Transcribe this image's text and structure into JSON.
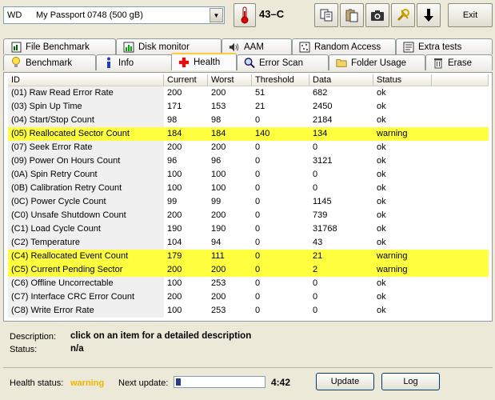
{
  "toolbar": {
    "drive_brand": "WD",
    "drive_model": "My Passport 0748 (500 gB)",
    "temperature": "43–C",
    "exit_label": "Exit"
  },
  "tabs_row1": [
    {
      "label": "File Benchmark",
      "icon": "file-benchmark-icon"
    },
    {
      "label": "Disk monitor",
      "icon": "disk-monitor-icon"
    },
    {
      "label": "AAM",
      "icon": "speaker-icon"
    },
    {
      "label": "Random Access",
      "icon": "random-access-icon"
    },
    {
      "label": "Extra tests",
      "icon": "extra-tests-icon"
    }
  ],
  "tabs_row2": [
    {
      "label": "Benchmark",
      "icon": "benchmark-icon"
    },
    {
      "label": "Info",
      "icon": "info-icon"
    },
    {
      "label": "Health",
      "icon": "health-icon",
      "active": true
    },
    {
      "label": "Error Scan",
      "icon": "error-scan-icon"
    },
    {
      "label": "Folder Usage",
      "icon": "folder-icon"
    },
    {
      "label": "Erase",
      "icon": "erase-icon"
    }
  ],
  "table": {
    "headers": [
      "ID",
      "Current",
      "Worst",
      "Threshold",
      "Data",
      "Status"
    ],
    "rows": [
      [
        "(01) Raw Read Error Rate",
        "200",
        "200",
        "51",
        "682",
        "ok"
      ],
      [
        "(03) Spin Up Time",
        "171",
        "153",
        "21",
        "2450",
        "ok"
      ],
      [
        "(04) Start/Stop Count",
        "98",
        "98",
        "0",
        "2184",
        "ok"
      ],
      [
        "(05) Reallocated Sector Count",
        "184",
        "184",
        "140",
        "134",
        "warning"
      ],
      [
        "(07) Seek Error Rate",
        "200",
        "200",
        "0",
        "0",
        "ok"
      ],
      [
        "(09) Power On Hours Count",
        "96",
        "96",
        "0",
        "3121",
        "ok"
      ],
      [
        "(0A) Spin Retry Count",
        "100",
        "100",
        "0",
        "0",
        "ok"
      ],
      [
        "(0B) Calibration Retry Count",
        "100",
        "100",
        "0",
        "0",
        "ok"
      ],
      [
        "(0C) Power Cycle Count",
        "99",
        "99",
        "0",
        "1145",
        "ok"
      ],
      [
        "(C0) Unsafe Shutdown Count",
        "200",
        "200",
        "0",
        "739",
        "ok"
      ],
      [
        "(C1) Load Cycle Count",
        "190",
        "190",
        "0",
        "31768",
        "ok"
      ],
      [
        "(C2) Temperature",
        "104",
        "94",
        "0",
        "43",
        "ok"
      ],
      [
        "(C4) Reallocated Event Count",
        "179",
        "111",
        "0",
        "21",
        "warning"
      ],
      [
        "(C5) Current Pending Sector",
        "200",
        "200",
        "0",
        "2",
        "warning"
      ],
      [
        "(C6) Offline Uncorrectable",
        "100",
        "253",
        "0",
        "0",
        "ok"
      ],
      [
        "(C7) Interface CRC Error Count",
        "200",
        "200",
        "0",
        "0",
        "ok"
      ],
      [
        "(C8) Write Error Rate",
        "100",
        "253",
        "0",
        "0",
        "ok"
      ]
    ]
  },
  "description": {
    "label": "Description:",
    "text": "click on an item for a detailed description",
    "status_label": "Status:",
    "status_text": "n/a"
  },
  "footer": {
    "health_label": "Health status:",
    "health_value": "warning",
    "next_update_label": "Next update:",
    "progress_fraction": 0.05,
    "countdown": "4:42",
    "update_label": "Update",
    "log_label": "Log"
  },
  "colors": {
    "warning_row": "#ffff40",
    "warning_text": "#f0b400",
    "window_bg": "#ece9d8"
  }
}
